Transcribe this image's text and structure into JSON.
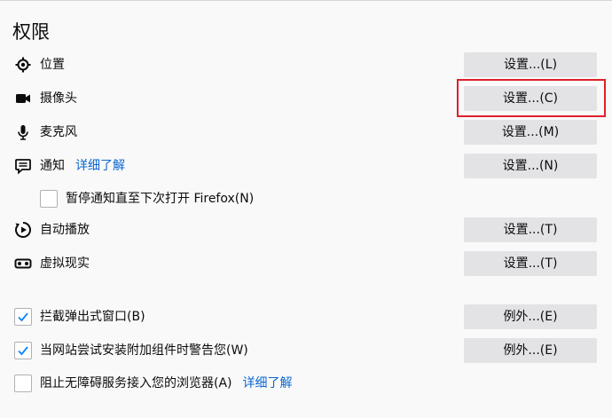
{
  "section": {
    "title": "权限"
  },
  "permissions": {
    "location": {
      "label": "位置",
      "button": "设置...(L)",
      "icon": "location-icon"
    },
    "camera": {
      "label": "摄像头",
      "button": "设置...(C)",
      "icon": "camera-icon"
    },
    "microphone": {
      "label": "麦克风",
      "button": "设置...(M)",
      "icon": "microphone-icon"
    },
    "notifications": {
      "label": "通知",
      "link": "详细了解",
      "button": "设置...(N)",
      "icon": "notification-icon"
    },
    "pause_notifications": {
      "label": "暂停通知直至下次打开 Firefox(N)",
      "checked": false
    },
    "autoplay": {
      "label": "自动播放",
      "button": "设置...(T)",
      "icon": "autoplay-icon"
    },
    "vr": {
      "label": "虚拟现实",
      "button": "设置...(T)",
      "icon": "vr-icon"
    }
  },
  "checkboxes": {
    "block_popups": {
      "label": "拦截弹出式窗口(B)",
      "checked": true,
      "button": "例外...(E)"
    },
    "warn_addons": {
      "label": "当网站尝试安装附加组件时警告您(W)",
      "checked": true,
      "button": "例外...(E)"
    },
    "block_accessibility": {
      "label": "阻止无障碍服务接入您的浏览器(A)",
      "link": "详细了解",
      "checked": false
    }
  },
  "colors": {
    "accent_link": "#0a67d1",
    "highlight_border": "#e0202a",
    "button_bg": "#e3e3e5",
    "check_color": "#0a84ff"
  }
}
